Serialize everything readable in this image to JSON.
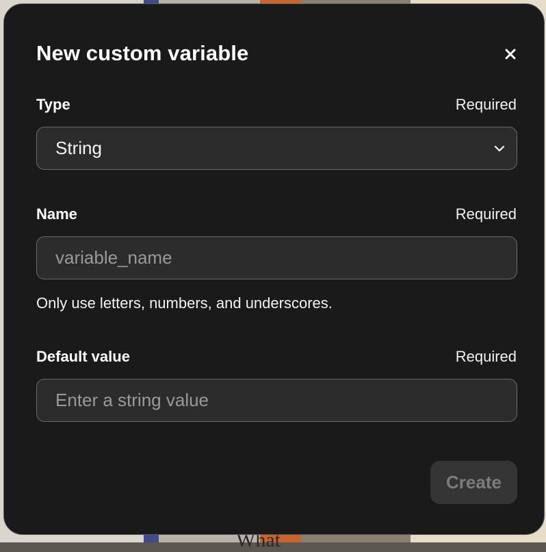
{
  "background": {
    "partial_text": "What",
    "colors": {
      "overlay": "#5b5750",
      "accent_blue": "#3f4a8a",
      "accent_orange": "#c9642c"
    }
  },
  "dialog": {
    "title": "New custom variable",
    "close_icon": "close-icon",
    "fields": {
      "type": {
        "label": "Type",
        "required": "Required",
        "selected_value": "String",
        "icon": "chevron-down-icon"
      },
      "name": {
        "label": "Name",
        "required": "Required",
        "value": "",
        "placeholder": "variable_name",
        "hint": "Only use letters, numbers, and underscores."
      },
      "default_value": {
        "label": "Default value",
        "required": "Required",
        "value": "",
        "placeholder": "Enter a string value"
      }
    },
    "create_label": "Create",
    "colors": {
      "dialog_bg": "#1a1a1a",
      "input_bg": "#2c2c2c",
      "input_border": "#6a6a6a",
      "button_bg": "#353535",
      "button_text_disabled": "#7c7c7c",
      "text": "#ffffff",
      "placeholder": "#9a9a9a"
    }
  }
}
